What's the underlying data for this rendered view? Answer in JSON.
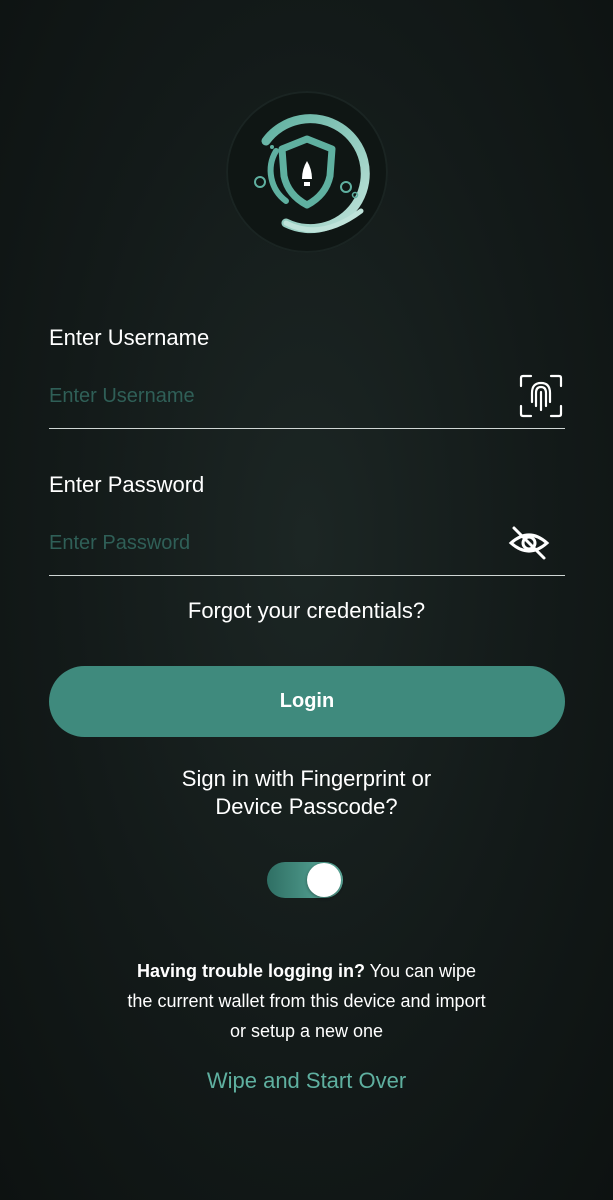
{
  "username": {
    "label": "Enter Username",
    "placeholder": "Enter Username",
    "value": ""
  },
  "password": {
    "label": "Enter Password",
    "placeholder": "Enter Password",
    "value": ""
  },
  "forgot_label": "Forgot your credentials?",
  "login_label": "Login",
  "biometric": {
    "line1": "Sign in with Fingerprint or",
    "line2": "Device Passcode?",
    "enabled": true
  },
  "trouble": {
    "bold": "Having trouble logging in?",
    "line1_rest": " You can wipe",
    "line2": "the current wallet from this device and import",
    "line3": "or setup a new one"
  },
  "wipe_label": "Wipe and Start Over",
  "colors": {
    "accent": "#3f8a7d",
    "accent_light": "#5fb0a0",
    "background": "#131a19"
  },
  "icons": {
    "logo": "shield-rocket-planet-logo",
    "username_action": "fingerprint-icon",
    "password_action": "eye-off-icon"
  }
}
